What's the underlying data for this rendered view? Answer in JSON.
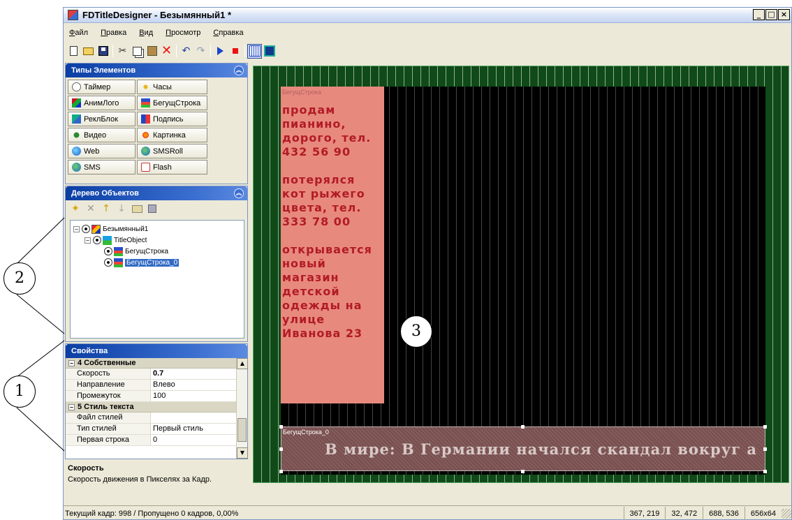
{
  "window": {
    "title": "FDTitleDesigner - Безымянный1 *",
    "buttons": {
      "minimize": "_",
      "maximize": "□",
      "close": "×"
    }
  },
  "menu": [
    "Файл",
    "Правка",
    "Вид",
    "Просмотр",
    "Справка"
  ],
  "toolbar_icons": [
    "new-icon",
    "open-icon",
    "save-icon",
    "cut-icon",
    "copy-icon",
    "paste-icon",
    "delete-icon",
    "undo-icon",
    "redo-icon",
    "play-icon",
    "stop-icon",
    "grid-icon",
    "view-icon"
  ],
  "element_types": {
    "title": "Типы Элементов",
    "items": [
      {
        "label": "Таймер",
        "icon": "timer-icon"
      },
      {
        "label": "Часы",
        "icon": "clock-icon"
      },
      {
        "label": "АнимЛого",
        "icon": "animlogo-icon"
      },
      {
        "label": "БегущСтрока",
        "icon": "ticker-icon"
      },
      {
        "label": "РеклБлок",
        "icon": "adblock-icon"
      },
      {
        "label": "Подпись",
        "icon": "caption-icon"
      },
      {
        "label": "Видео",
        "icon": "video-icon"
      },
      {
        "label": "Картинка",
        "icon": "picture-icon"
      },
      {
        "label": "Web",
        "icon": "web-icon"
      },
      {
        "label": "SMSRoll",
        "icon": "smsroll-icon"
      },
      {
        "label": "SMS",
        "icon": "sms-icon"
      },
      {
        "label": "Flash",
        "icon": "flash-icon"
      }
    ]
  },
  "object_tree": {
    "title": "Дерево Объектов",
    "nodes": [
      {
        "label": "Безымянный1",
        "level": 0,
        "expander": "−"
      },
      {
        "label": "TitleObject",
        "level": 1,
        "expander": "−"
      },
      {
        "label": "БегущСтрока",
        "level": 2
      },
      {
        "label": "БегущСтрока_0",
        "level": 2,
        "selected": true
      }
    ]
  },
  "properties": {
    "title": "Свойства",
    "group1": {
      "expander": "−",
      "label": "4 Собственные"
    },
    "group1_rows": [
      {
        "name": "Скорость",
        "value": "0.7"
      },
      {
        "name": "Направление",
        "value": "Влево"
      },
      {
        "name": "Промежуток",
        "value": "100"
      }
    ],
    "group2": {
      "expander": "−",
      "label": "5 Стиль текста"
    },
    "group2_rows": [
      {
        "name": "Файл стилей",
        "value": ""
      },
      {
        "name": "Тип стилей",
        "value": "Первый стиль"
      },
      {
        "name": "Первая строка",
        "value": "0"
      }
    ],
    "scroll_up": "▲",
    "scroll_down": "▼"
  },
  "help": {
    "title": "Скорость",
    "text": "Скорость движения в Пикселях за Кадр."
  },
  "canvas": {
    "vertical_ticker": {
      "label": "БегущСтрока",
      "text": "продам\nпианино,\nдорого, тел.\n432 56 90\n\nпотерялся\nкот рыжего\nцвета, тел.\n333 78 00\n\nоткрывается\nновый\nмагазин\nдетской\nодежды на\nулице\nИванова 23"
    },
    "horizontal_ticker": {
      "label": "БегущСтрока_0",
      "text": "В мире:   В Германии начался скандал вокруг а"
    }
  },
  "status": {
    "main": "Текущий кадр: 998 / Пропущено 0 кадров,  0,00%",
    "cells": [
      "367, 219",
      "32, 472",
      "688, 536",
      "656x64"
    ]
  },
  "callouts": [
    "1",
    "2",
    "3"
  ],
  "colors": {
    "canvas_bg": "#0f4a18",
    "ticker_bg": "#e8897e",
    "ticker_text": "#b11b25",
    "selection": "#316ac5"
  }
}
